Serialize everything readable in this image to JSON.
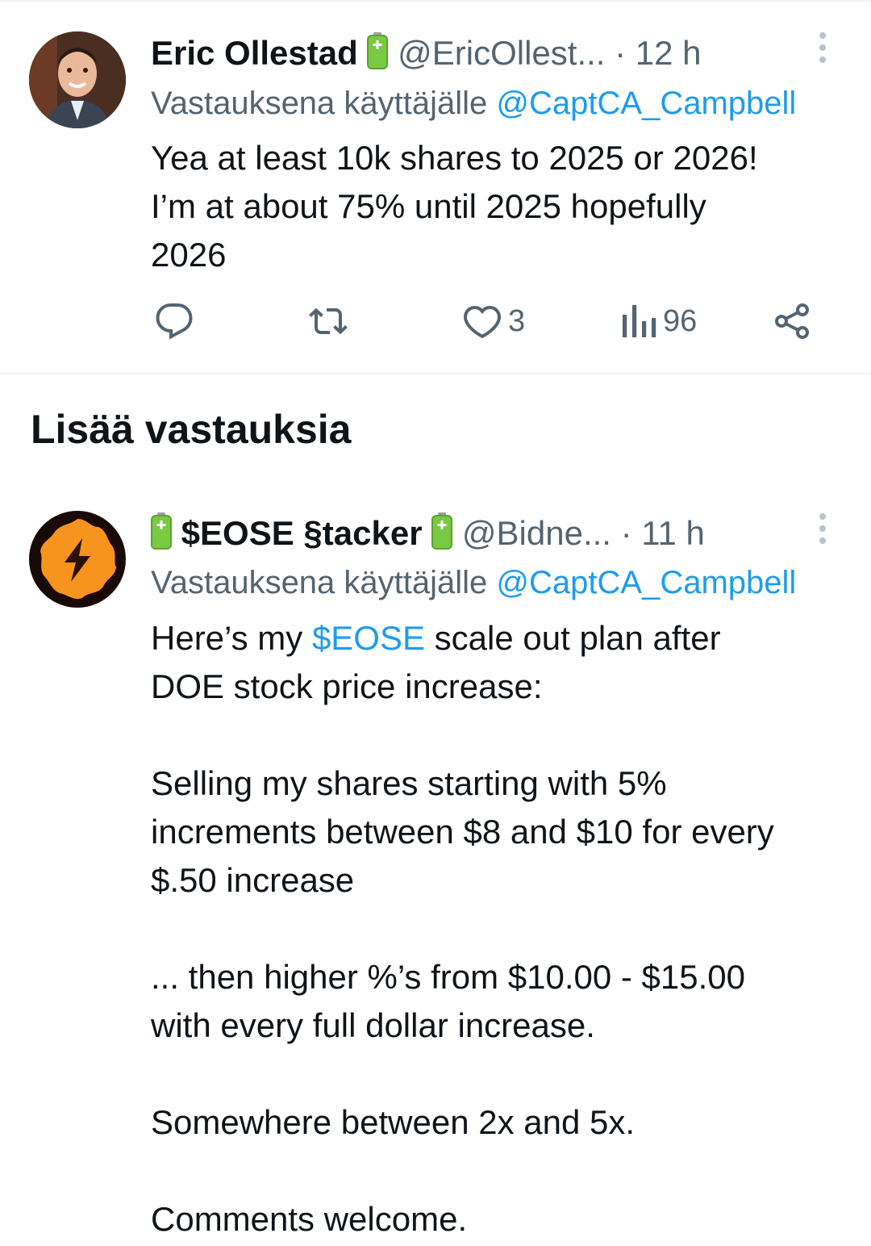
{
  "tweet1": {
    "name": "Eric Ollestad",
    "handle": "@EricOllest...",
    "dot": " · ",
    "time": "12 h",
    "reply_prefix": "Vastauksena käyttäjälle ",
    "reply_mention": "@CaptCA_Campbell",
    "text_lines": [
      "Yea at least 10k shares to 2025 or 2026!",
      "I’m at about 75% until 2025 hopefully",
      "2026"
    ],
    "actions": {
      "reply_icon": "reply-icon",
      "retweet_icon": "retweet-icon",
      "like_icon": "heart-icon",
      "like_count": "3",
      "views_icon": "views-icon",
      "views_count": "96",
      "share_icon": "share-icon"
    }
  },
  "section": {
    "title": "Lisää vastauksia"
  },
  "tweet2": {
    "name": "$EOSE §tacker",
    "handle": "@Bidne...",
    "dot": " · ",
    "time": "11 h",
    "reply_prefix": "Vastauksena käyttäjälle ",
    "reply_mention": "@CaptCA_Campbell",
    "text_intro_before": "Here’s my ",
    "text_cashtag": "$EOSE",
    "text_intro_after": " scale out plan after",
    "text_intro_line2": "DOE stock price increase:",
    "para2_lines": [
      "Selling my shares starting with 5%",
      "increments between $8 and $10 for every",
      "$.50 increase"
    ],
    "para3_lines": [
      "... then higher %’s from $10.00 - $15.00",
      "with every full dollar increase."
    ],
    "para4": "Somewhere between 2x and 5x.",
    "para5": "Comments welcome."
  },
  "colors": {
    "text": "#0f1419",
    "secondary": "#536471",
    "link": "#1d9bf0",
    "divider": "#eff3f4",
    "battery_green": "#7ac943",
    "avatar2_bg": "#f7941d"
  }
}
